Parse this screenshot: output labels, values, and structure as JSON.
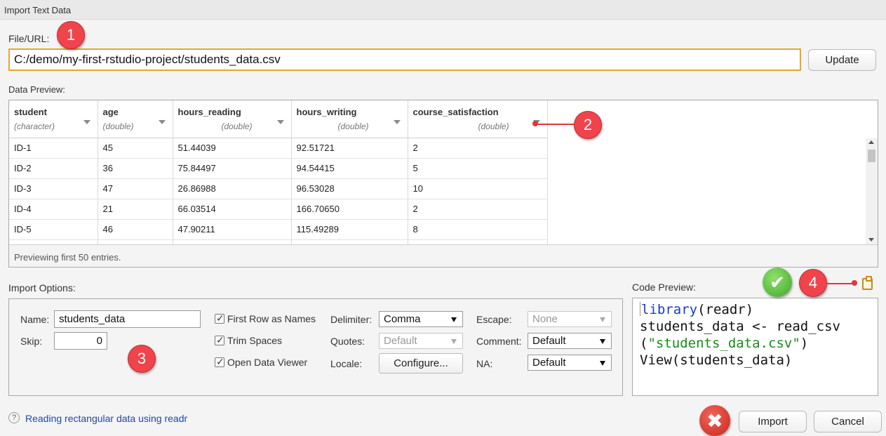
{
  "window": {
    "title": "Import Text Data"
  },
  "file": {
    "label": "File/URL:",
    "value": "C:/demo/my-first-rstudio-project/students_data.csv",
    "update_label": "Update"
  },
  "preview": {
    "label": "Data Preview:",
    "columns": [
      {
        "name": "student",
        "type": "(character)"
      },
      {
        "name": "age",
        "type": "(double)"
      },
      {
        "name": "hours_reading",
        "type": "(double)"
      },
      {
        "name": "hours_writing",
        "type": "(double)"
      },
      {
        "name": "course_satisfaction",
        "type": "(double)"
      }
    ],
    "rows": [
      [
        "ID-1",
        "45",
        "51.44039",
        "92.51721",
        "2"
      ],
      [
        "ID-2",
        "36",
        "75.84497",
        "94.54415",
        "5"
      ],
      [
        "ID-3",
        "47",
        "26.86988",
        "96.53028",
        "10"
      ],
      [
        "ID-4",
        "21",
        "66.03514",
        "166.70650",
        "2"
      ],
      [
        "ID-5",
        "46",
        "47.90211",
        "115.49289",
        "8"
      ]
    ],
    "footer": "Previewing first 50 entries."
  },
  "options": {
    "label": "Import Options:",
    "name_label": "Name:",
    "name_value": "students_data",
    "skip_label": "Skip:",
    "skip_value": "0",
    "first_row_label": "First Row as Names",
    "trim_label": "Trim Spaces",
    "viewer_label": "Open Data Viewer",
    "delimiter_label": "Delimiter:",
    "delimiter_value": "Comma",
    "quotes_label": "Quotes:",
    "quotes_value": "Default",
    "locale_label": "Locale:",
    "configure_label": "Configure...",
    "escape_label": "Escape:",
    "escape_value": "None",
    "comment_label": "Comment:",
    "comment_value": "Default",
    "na_label": "NA:",
    "na_value": "Default"
  },
  "code": {
    "label": "Code Preview:",
    "l1_kw": "library",
    "l1_rest": "(readr)",
    "l2": "students_data <- read_csv",
    "l3_open": "(",
    "l3_str": "\"students_data.csv\"",
    "l3_close": ")",
    "l4": "View(students_data)"
  },
  "help": {
    "label": "Reading rectangular data using readr",
    "icon": "?"
  },
  "actions": {
    "import_label": "Import",
    "cancel_label": "Cancel"
  },
  "callouts": {
    "c1": "1",
    "c2": "2",
    "c3": "3",
    "c4": "4"
  },
  "icons": {
    "ok": "✔",
    "cancel": "✖"
  },
  "colors": {
    "accent_border": "#e3a72f",
    "callout": "#f0444c",
    "link": "#1f47b3",
    "keyword": "#1c3dbd",
    "string": "#1a8a1a"
  }
}
